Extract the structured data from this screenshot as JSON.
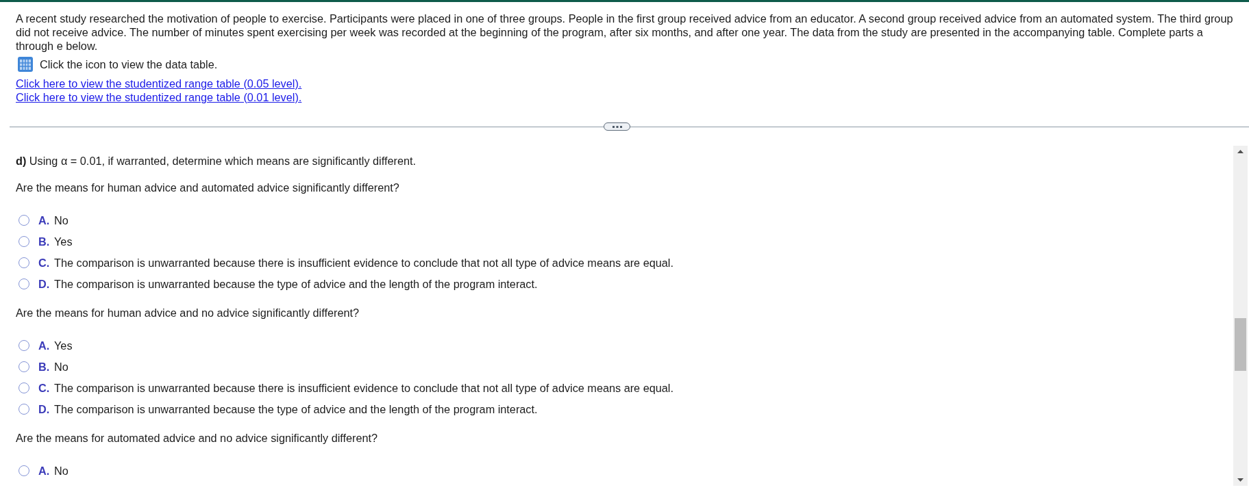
{
  "intro": {
    "text": "A recent study researched the motivation of people to exercise. Participants were placed in one of three groups. People in the first group received advice from an educator. A second group received advice from an automated system. The third group did not receive advice. The number of minutes spent exercising per week was recorded at the beginning of the program, after six months, and after one year. The data from the study are presented in the accompanying table. Complete parts a through e below.",
    "data_table_hint": "Click the icon to view the data table.",
    "links": [
      "Click here to view the studentized range table (0.05 level).",
      "Click here to view the studentized range table (0.01 level)."
    ]
  },
  "part": {
    "instruction": "**d)** Using α = 0.01, if warranted, determine which means are significantly different."
  },
  "questions": [
    {
      "prompt": "Are the means for human advice and automated advice significantly different?",
      "options": [
        {
          "letter": "A.",
          "text": "No",
          "selected": false
        },
        {
          "letter": "B.",
          "text": "Yes",
          "selected": false
        },
        {
          "letter": "C.",
          "text": "The comparison is unwarranted because there is insufficient evidence to conclude that not all type of advice means are equal.",
          "selected": false
        },
        {
          "letter": "D.",
          "text": "The comparison is unwarranted because the type of advice and the length of the program interact.",
          "selected": false
        }
      ]
    },
    {
      "prompt": "Are the means for human advice and no advice significantly different?",
      "options": [
        {
          "letter": "A.",
          "text": "Yes",
          "selected": false
        },
        {
          "letter": "B.",
          "text": "No",
          "selected": false
        },
        {
          "letter": "C.",
          "text": "The comparison is unwarranted because there is insufficient evidence to conclude that not all type of advice means are equal.",
          "selected": false
        },
        {
          "letter": "D.",
          "text": "The comparison is unwarranted because the type of advice and the length of the program interact.",
          "selected": false
        }
      ]
    },
    {
      "prompt": "Are the means for automated advice and no advice significantly different?",
      "options": [
        {
          "letter": "A.",
          "text": "No",
          "selected": false
        }
      ]
    }
  ]
}
